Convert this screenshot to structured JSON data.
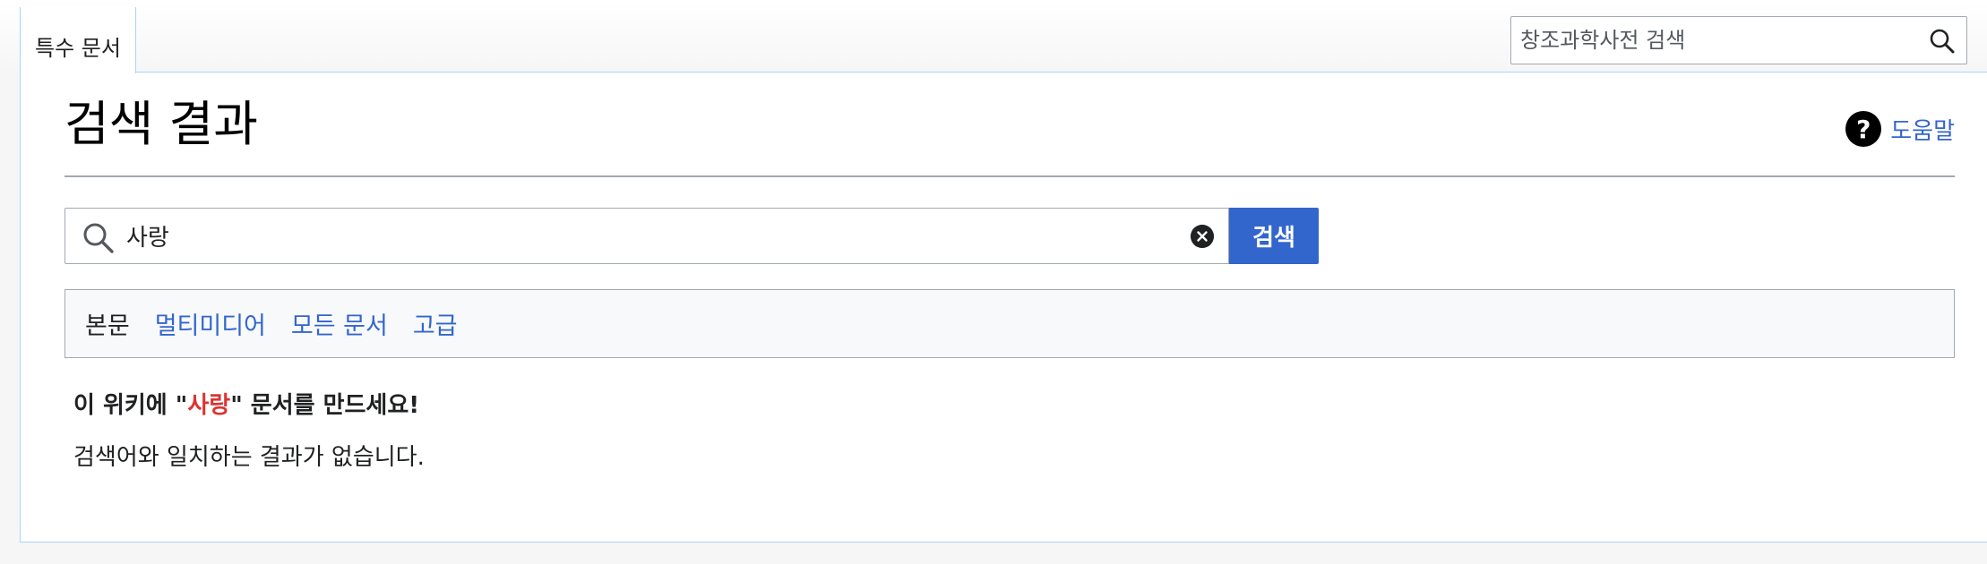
{
  "header": {
    "tab_label": "특수 문서",
    "search_placeholder": "창조과학사전 검색"
  },
  "page": {
    "title": "검색 결과",
    "help_label": "도움말",
    "help_icon_glyph": "?"
  },
  "search": {
    "value": "사랑",
    "button_label": "검색"
  },
  "profiles": {
    "items": [
      {
        "label": "본문",
        "active": true
      },
      {
        "label": "멀티미디어",
        "active": false
      },
      {
        "label": "모든 문서",
        "active": false
      },
      {
        "label": "고급",
        "active": false
      }
    ]
  },
  "results": {
    "create_prefix": "이 위키에 \"",
    "create_link": "사랑",
    "create_suffix": "\" 문서를 만드세요!",
    "no_results": "검색어와 일치하는 결과가 없습니다."
  },
  "colors": {
    "link": "#3366cc",
    "red_link": "#dd3333",
    "button_bg": "#3366cc",
    "border": "#a2a9b1",
    "frame_border": "#a7d7f9"
  },
  "icons": {
    "header_search": "search-icon",
    "main_search": "search-icon",
    "clear": "clear-icon",
    "help": "help-icon"
  }
}
